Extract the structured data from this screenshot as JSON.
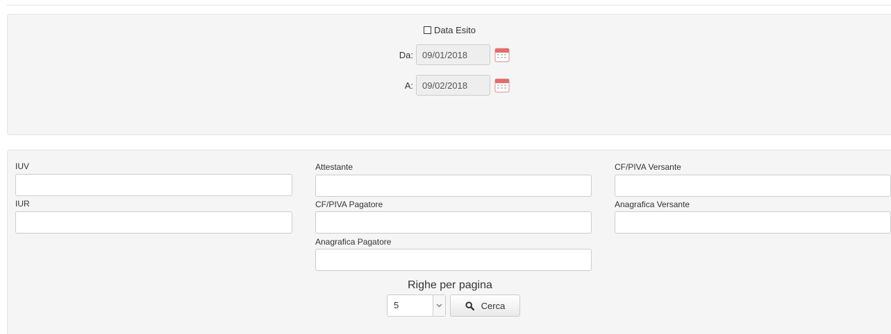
{
  "date_filter": {
    "checkbox_label": "Data Esito",
    "checked": false,
    "from_label": "Da:",
    "from_value": "09/01/2018",
    "to_label": "A:",
    "to_value": "09/02/2018"
  },
  "filters": {
    "iuv_label": "IUV",
    "iur_label": "IUR",
    "attestante_label": "Attestante",
    "cf_piva_pagatore_label": "CF/PIVA Pagatore",
    "anagrafica_pagatore_label": "Anagrafica Pagatore",
    "cf_piva_versante_label": "CF/PIVA Versante",
    "anagrafica_versante_label": "Anagrafica Versante"
  },
  "pagination": {
    "rows_per_page_label": "Righe per pagina",
    "rows_per_page_value": "5",
    "search_button_label": "Cerca"
  },
  "icons": {
    "calendar": "calendar-icon",
    "search": "search-icon",
    "dropdown": "chevron-down-icon"
  }
}
